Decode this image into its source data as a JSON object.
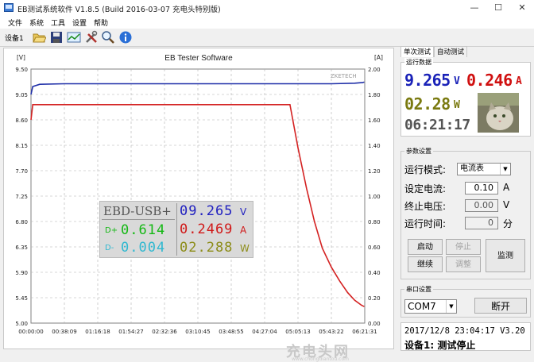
{
  "window": {
    "title": "EB测试系统软件 V1.8.5 (Build 2016-03-07 充电头特别版)",
    "minimize": "—",
    "maximize": "☐",
    "close": "✕"
  },
  "menu": [
    "文件",
    "系统",
    "工具",
    "设置",
    "帮助"
  ],
  "toolbar": {
    "device_label": "设备1",
    "icons": [
      "open-folder-icon",
      "save-icon",
      "chart-icon",
      "tools-icon",
      "search-icon",
      "info-icon"
    ]
  },
  "chart_data": {
    "type": "line",
    "title": "EB Tester Software",
    "brand": "ZKETECH",
    "left_axis_unit": "[V]",
    "right_axis_unit": "[A]",
    "left_ticks": [
      "9.50",
      "9.05",
      "8.60",
      "8.15",
      "7.70",
      "7.25",
      "6.80",
      "6.35",
      "5.90",
      "5.45",
      "5.00"
    ],
    "right_ticks": [
      "2.00",
      "1.80",
      "1.60",
      "1.40",
      "1.20",
      "1.00",
      "0.80",
      "0.60",
      "0.40",
      "0.20",
      "0.00"
    ],
    "x_ticks": [
      "00:00:00",
      "00:38:09",
      "01:16:18",
      "01:54:27",
      "02:32:36",
      "03:10:45",
      "03:48:55",
      "04:27:04",
      "05:05:13",
      "05:43:22",
      "06:21:31"
    ],
    "ylim_left": [
      5.0,
      9.5
    ],
    "ylim_right": [
      0.0,
      2.0
    ],
    "grid": true,
    "series": [
      {
        "axis": "left",
        "color": "#1f2fa8",
        "x": [
          "00:00:00",
          "00:02:00",
          "00:10:00",
          "00:38:09",
          "01:54:27",
          "03:10:45",
          "04:27:04",
          "05:05:13",
          "05:43:22",
          "06:10:00",
          "06:18:00",
          "06:19:00",
          "06:21:00"
        ],
        "values": [
          9.05,
          9.19,
          9.23,
          9.24,
          9.24,
          9.24,
          9.24,
          9.24,
          9.24,
          9.25,
          9.26,
          9.26,
          9.27
        ]
      },
      {
        "axis": "right",
        "color": "#d42222",
        "x": [
          "00:00:00",
          "00:02:00",
          "00:38:09",
          "01:54:27",
          "03:10:45",
          "04:27:04",
          "04:56:00",
          "05:05:13",
          "05:15:00",
          "05:24:00",
          "05:33:00",
          "05:43:22",
          "05:53:00",
          "06:02:00",
          "06:10:00",
          "06:18:00",
          "06:21:00"
        ],
        "values": [
          1.6,
          1.72,
          1.72,
          1.72,
          1.72,
          1.72,
          1.72,
          1.38,
          1.06,
          0.8,
          0.59,
          0.44,
          0.33,
          0.24,
          0.18,
          0.14,
          0.13
        ]
      }
    ]
  },
  "overlay": {
    "title": "EBD-USB+",
    "d_plus_label": "D+",
    "d_plus": "0.614",
    "d_minus_label": "D-",
    "d_minus": "0.004",
    "voltage": "09.265",
    "voltage_unit": "V",
    "current": "0.2469",
    "current_unit": "A",
    "power": "02.288",
    "power_unit": "W",
    "colors": {
      "blue": "#2020c0",
      "red": "#d01818",
      "green": "#14b814",
      "cyan": "#30b8d0",
      "olive": "#8c8c18"
    }
  },
  "watermark": {
    "main": "充电头网",
    "sub": "www.chongdiantou.com"
  },
  "tabs": [
    "单次测试",
    "自动测试"
  ],
  "readings": {
    "group_label": "运行数据",
    "voltage": "9.265",
    "voltage_unit": "V",
    "current": "0.246",
    "current_unit": "A",
    "power": "02.28",
    "power_unit": "W",
    "time": "06:21:17",
    "colors": {
      "voltage": "#1a22b8",
      "current": "#d01010",
      "power": "#7a7a10",
      "time": "#555555"
    }
  },
  "params": {
    "group_label": "参数设置",
    "mode_label": "运行模式:",
    "mode_value": "电流表",
    "current_label": "设定电流:",
    "current_value": "0.10",
    "current_unit": "A",
    "voltage_label": "终止电压:",
    "voltage_value": "0.00",
    "voltage_unit": "V",
    "time_label": "运行时间:",
    "time_value": "0",
    "time_unit": "分",
    "start": "启动",
    "stop": "停止",
    "continue": "继续",
    "adjust": "调整",
    "monitor": "监测"
  },
  "serial": {
    "group_label": "串口设置",
    "port": "COM7",
    "disconnect": "断开"
  },
  "status": {
    "line1": "2017/12/8 23:04:17  V3.20",
    "line2": "设备1: 测试停止"
  }
}
